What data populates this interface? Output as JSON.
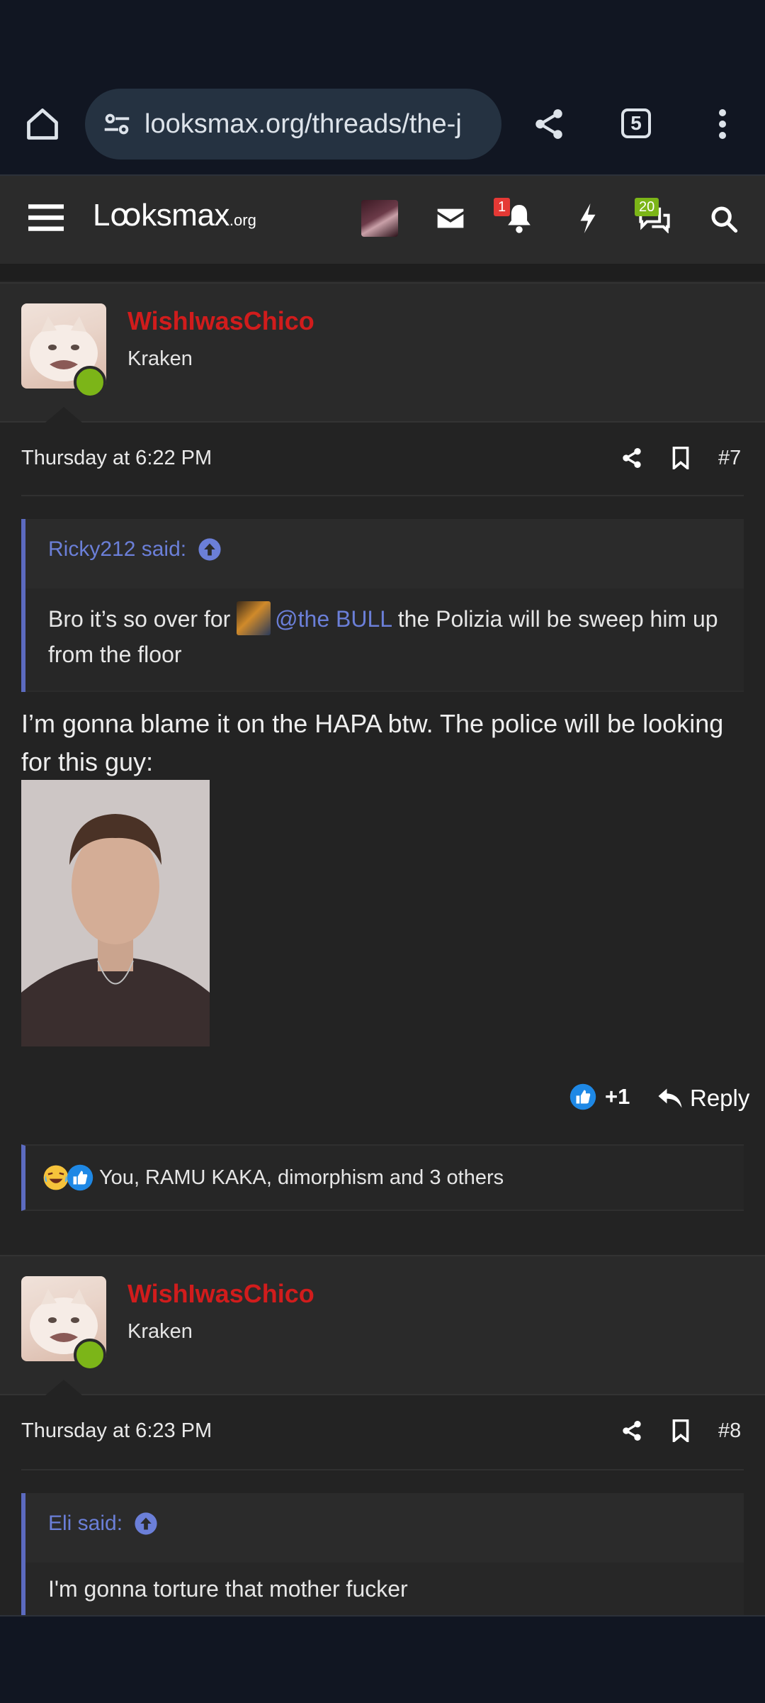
{
  "browser": {
    "url": "looksmax.org/threads/the-j",
    "tab_count": "5"
  },
  "site": {
    "logo_main": "Lꝏksmax",
    "logo_suffix": ".org",
    "notifications_badge": "1",
    "conversations_badge": "20"
  },
  "posts": [
    {
      "username": "WishIwasChico",
      "user_title": "Kraken",
      "time": "Thursday at 6:22 PM",
      "post_number": "#7",
      "quote": {
        "author": "Ricky212 said:",
        "text_before": "Bro it’s so over for ",
        "mention": "@the BULL",
        "text_after": " the Polizia will be sweep him up from the floor"
      },
      "message": "I’m gonna blame it on the HAPA btw. The police will be looking for this guy:",
      "reaction_score": "+1",
      "reply_label": "Reply",
      "reactions_text": "You, RAMU KAKA, dimorphism and 3 others"
    },
    {
      "username": "WishIwasChico",
      "user_title": "Kraken",
      "time": "Thursday at 6:23 PM",
      "post_number": "#8",
      "quote": {
        "author": "Eli said:",
        "text": "I'm gonna torture that mother fucker"
      }
    }
  ],
  "colors": {
    "username": "#d11c1c",
    "quote_accent": "#5c6bc0",
    "online": "#7cb518",
    "badge_red": "#e53935",
    "badge_green": "#7cb518"
  },
  "icons": [
    "home-icon",
    "site-info-icon",
    "share-icon",
    "overflow-menu-icon",
    "menu-icon",
    "mail-icon",
    "bell-icon",
    "bolt-icon",
    "chat-icon",
    "search-icon",
    "arrow-up-circle-icon",
    "bookmark-icon",
    "like-icon",
    "reply-icon",
    "laugh-emoji-icon"
  ]
}
